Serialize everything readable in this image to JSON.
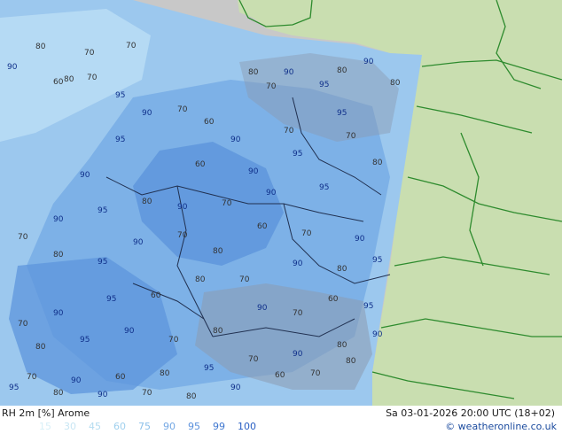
{
  "header": {
    "product": "RH 2m [%] Arome",
    "datetime": "Sa 03-01-2026 20:00 UTC (18+02)"
  },
  "legend": {
    "values": [
      "15",
      "30",
      "45",
      "60",
      "75",
      "90",
      "95",
      "99",
      "100"
    ],
    "colors": [
      "#d8f0f8",
      "#c8e6f4",
      "#b4dcf0",
      "#a0d0ee",
      "#8cc0ea",
      "#74a8e4",
      "#5a90dc",
      "#4078d0",
      "#2a60c4"
    ]
  },
  "copyright": "© weatheronline.co.uk",
  "map": {
    "land_color": "#c9deb0",
    "sea_color": "#c8c8c8",
    "border_color": "#2e8b2e",
    "model_area_colors": [
      "#9cc8ee",
      "#7aaee6",
      "#5e96dc"
    ],
    "contour_labels": [
      "80",
      "60",
      "70",
      "70",
      "90",
      "80",
      "70",
      "95",
      "90",
      "70",
      "60",
      "80",
      "70",
      "90",
      "95",
      "80",
      "90",
      "80",
      "95",
      "70",
      "90",
      "60",
      "90",
      "95",
      "70",
      "80",
      "95",
      "90",
      "70",
      "90",
      "80",
      "95",
      "90",
      "70",
      "80",
      "95",
      "90",
      "70",
      "80",
      "60",
      "70",
      "90",
      "95",
      "80",
      "90",
      "70",
      "80",
      "60",
      "95",
      "90",
      "70",
      "80",
      "95",
      "90",
      "70",
      "80",
      "90",
      "70",
      "60",
      "95",
      "90",
      "80",
      "90",
      "70",
      "95",
      "80",
      "60",
      "90",
      "70",
      "95",
      "80",
      "90",
      "70",
      "80",
      "90",
      "60",
      "70",
      "80",
      "95",
      "90"
    ]
  }
}
